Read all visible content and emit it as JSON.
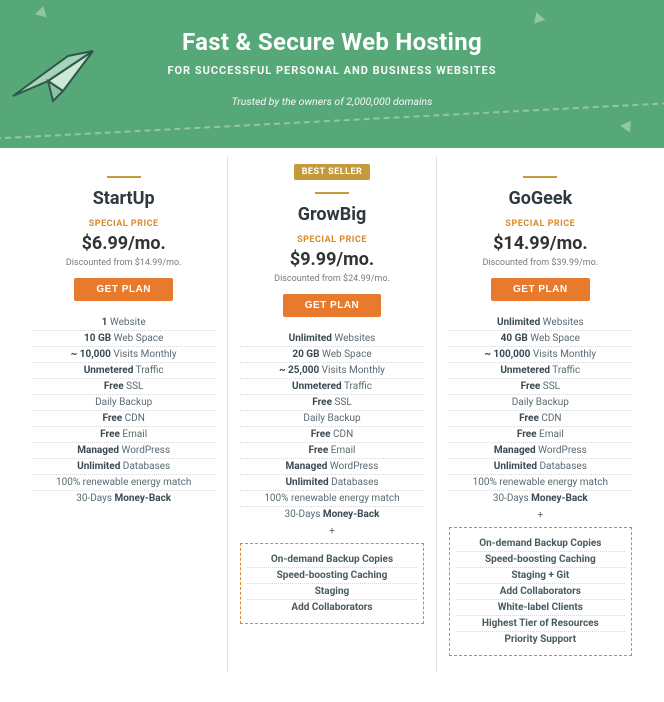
{
  "hero": {
    "title": "Fast & Secure Web Hosting",
    "subtitle": "FOR SUCCESSFUL PERSONAL AND BUSINESS WEBSITES",
    "trusted": "Trusted by the owners of 2,000,000 domains"
  },
  "common": {
    "special_label": "SPECIAL PRICE",
    "get_plan": "GET PLAN",
    "plus": "+"
  },
  "plans": [
    {
      "name": "StartUp",
      "price": "$6.99/mo.",
      "discount": "Discounted from $14.99/mo.",
      "features": [
        {
          "b": "1",
          "t": " Website"
        },
        {
          "b": "10 GB",
          "t": " Web Space"
        },
        {
          "b": "~ 10,000",
          "t": " Visits Monthly"
        },
        {
          "b": "Unmetered",
          "t": " Traffic"
        },
        {
          "b": "Free",
          "t": " SSL"
        },
        {
          "b": "",
          "t": "Daily Backup"
        },
        {
          "b": "Free",
          "t": " CDN"
        },
        {
          "b": "Free",
          "t": " Email"
        },
        {
          "b": "Managed",
          "t": " WordPress"
        },
        {
          "b": "Unlimited",
          "t": " Databases"
        },
        {
          "b": "",
          "t": "100% renewable energy match"
        },
        {
          "b": "",
          "t": "30-Days ",
          "b2": "Money-Back"
        }
      ]
    },
    {
      "badge": "BEST SELLER",
      "name": "GrowBig",
      "price": "$9.99/mo.",
      "discount": "Discounted from $24.99/mo.",
      "features": [
        {
          "b": "Unlimited",
          "t": " Websites",
          "hl": true
        },
        {
          "b": "20 GB",
          "t": " Web Space",
          "hl": true
        },
        {
          "b": "~ 25,000",
          "t": " Visits Monthly",
          "hl": true
        },
        {
          "b": "Unmetered",
          "t": " Traffic"
        },
        {
          "b": "Free",
          "t": " SSL"
        },
        {
          "b": "",
          "t": "Daily Backup"
        },
        {
          "b": "Free",
          "t": " CDN"
        },
        {
          "b": "Free",
          "t": " Email"
        },
        {
          "b": "Managed",
          "t": " WordPress"
        },
        {
          "b": "Unlimited",
          "t": " Databases"
        },
        {
          "b": "",
          "t": "100% renewable energy match"
        },
        {
          "b": "",
          "t": "30-Days ",
          "b2": "Money-Back"
        }
      ],
      "extras": [
        "On-demand Backup Copies",
        "Speed-boosting Caching",
        "Staging",
        "Add Collaborators"
      ]
    },
    {
      "name": "GoGeek",
      "price": "$14.99/mo.",
      "discount": "Discounted from $39.99/mo.",
      "features": [
        {
          "b": "Unlimited",
          "t": " Websites",
          "hl": true
        },
        {
          "b": "40 GB",
          "t": " Web Space",
          "hl": true
        },
        {
          "b": "~ 100,000",
          "t": " Visits Monthly",
          "hl": true
        },
        {
          "b": "Unmetered",
          "t": " Traffic"
        },
        {
          "b": "Free",
          "t": " SSL"
        },
        {
          "b": "",
          "t": "Daily Backup"
        },
        {
          "b": "Free",
          "t": " CDN"
        },
        {
          "b": "Free",
          "t": " Email"
        },
        {
          "b": "Managed",
          "t": " WordPress"
        },
        {
          "b": "Unlimited",
          "t": " Databases"
        },
        {
          "b": "",
          "t": "100% renewable energy match"
        },
        {
          "b": "",
          "t": "30-Days ",
          "b2": "Money-Back"
        }
      ],
      "extras": [
        "On-demand Backup Copies",
        "Speed-boosting Caching",
        "Staging + Git",
        "Add Collaborators",
        "White-label Clients",
        "Highest Tier of Resources",
        "Priority Support"
      ]
    }
  ]
}
